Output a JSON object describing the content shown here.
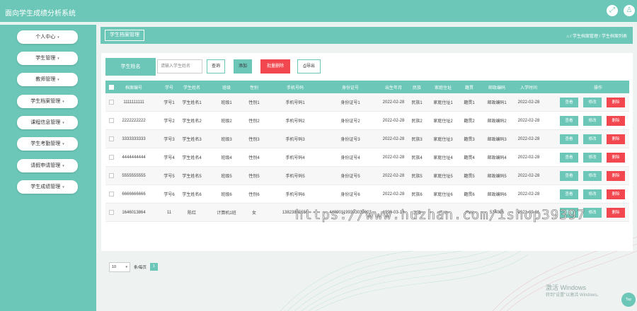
{
  "app": {
    "title": "面向学生成绩分析系统"
  },
  "header_icons": [
    "expand-icon",
    "user-icon"
  ],
  "sidebar": {
    "items": [
      {
        "label": "个人中心"
      },
      {
        "label": "学生管理"
      },
      {
        "label": "教师管理"
      },
      {
        "label": "学生档案管理"
      },
      {
        "label": "课程信息管理"
      },
      {
        "label": "学生考勤管理"
      },
      {
        "label": "请假申请管理"
      },
      {
        "label": "学生成绩管理"
      }
    ]
  },
  "breadcrumb": {
    "tab": "学生档案管理",
    "path": "⌂ / 学生档案管理 / 学生档案列表"
  },
  "search": {
    "label": "学生姓名",
    "placeholder": "请输入学生姓名",
    "query_label": "查询",
    "add_label": "添加",
    "batch_delete_label": "批量删除",
    "export_label": "导出"
  },
  "table": {
    "columns": [
      "档案编号",
      "学号",
      "学生姓名",
      "班级",
      "性别",
      "手机号码",
      "身份证号",
      "出生年月",
      "民族",
      "家庭住址",
      "籍贯",
      "邮政编码",
      "入学时间",
      "操作"
    ],
    "rows": [
      [
        "1111111111",
        "学号1",
        "学生姓名1",
        "班级1",
        "性别1",
        "手机号码1",
        "身份证号1",
        "2022-02-28",
        "民族1",
        "家庭住址1",
        "籍贯1",
        "邮政编码1",
        "2022-02-28"
      ],
      [
        "2222222222",
        "学号2",
        "学生姓名2",
        "班级2",
        "性别2",
        "手机号码2",
        "身份证号2",
        "2022-02-28",
        "民族2",
        "家庭住址2",
        "籍贯2",
        "邮政编码2",
        "2022-02-28"
      ],
      [
        "3333333333",
        "学号3",
        "学生姓名3",
        "班级3",
        "性别3",
        "手机号码3",
        "身份证号3",
        "2022-02-28",
        "民族3",
        "家庭住址3",
        "籍贯3",
        "邮政编码3",
        "2022-02-28"
      ],
      [
        "4444444444",
        "学号4",
        "学生姓名4",
        "班级4",
        "性别4",
        "手机号码4",
        "身份证号4",
        "2022-02-28",
        "民族4",
        "家庭住址4",
        "籍贯4",
        "邮政编码4",
        "2022-02-28"
      ],
      [
        "5555555555",
        "学号5",
        "学生姓名5",
        "班级5",
        "性别5",
        "手机号码5",
        "身份证号5",
        "2022-02-28",
        "民族5",
        "家庭住址5",
        "籍贯5",
        "邮政编码5",
        "2022-02-28"
      ],
      [
        "6666666666",
        "学号6",
        "学生姓名6",
        "班级6",
        "性别6",
        "手机号码6",
        "身份证号6",
        "2022-02-28",
        "民族6",
        "家庭住址6",
        "籍贯6",
        "邮政编码6",
        "2022-02-28"
      ],
      [
        "1646013864",
        "11",
        "陈红",
        "计算机1班",
        "女",
        "13823855556",
        "440901199303039003",
        "1999-03-19",
        "汉族",
        "广州",
        "广州",
        "514056",
        "2021-09-01"
      ]
    ],
    "actions": {
      "view": "查看",
      "edit": "修改",
      "delete": "删除"
    }
  },
  "pager": {
    "page_size": "10",
    "per_page_label": "条/每页",
    "current_page": "1"
  },
  "watermark": "https://www.huzhan.com/ishop39397",
  "windows_notice": {
    "title": "激活 Windows",
    "subtitle": "转到\"设置\"以激活 Windows。"
  },
  "top_button": "Top",
  "colors": {
    "accent": "#6cc7b8",
    "danger": "#f2474f"
  }
}
